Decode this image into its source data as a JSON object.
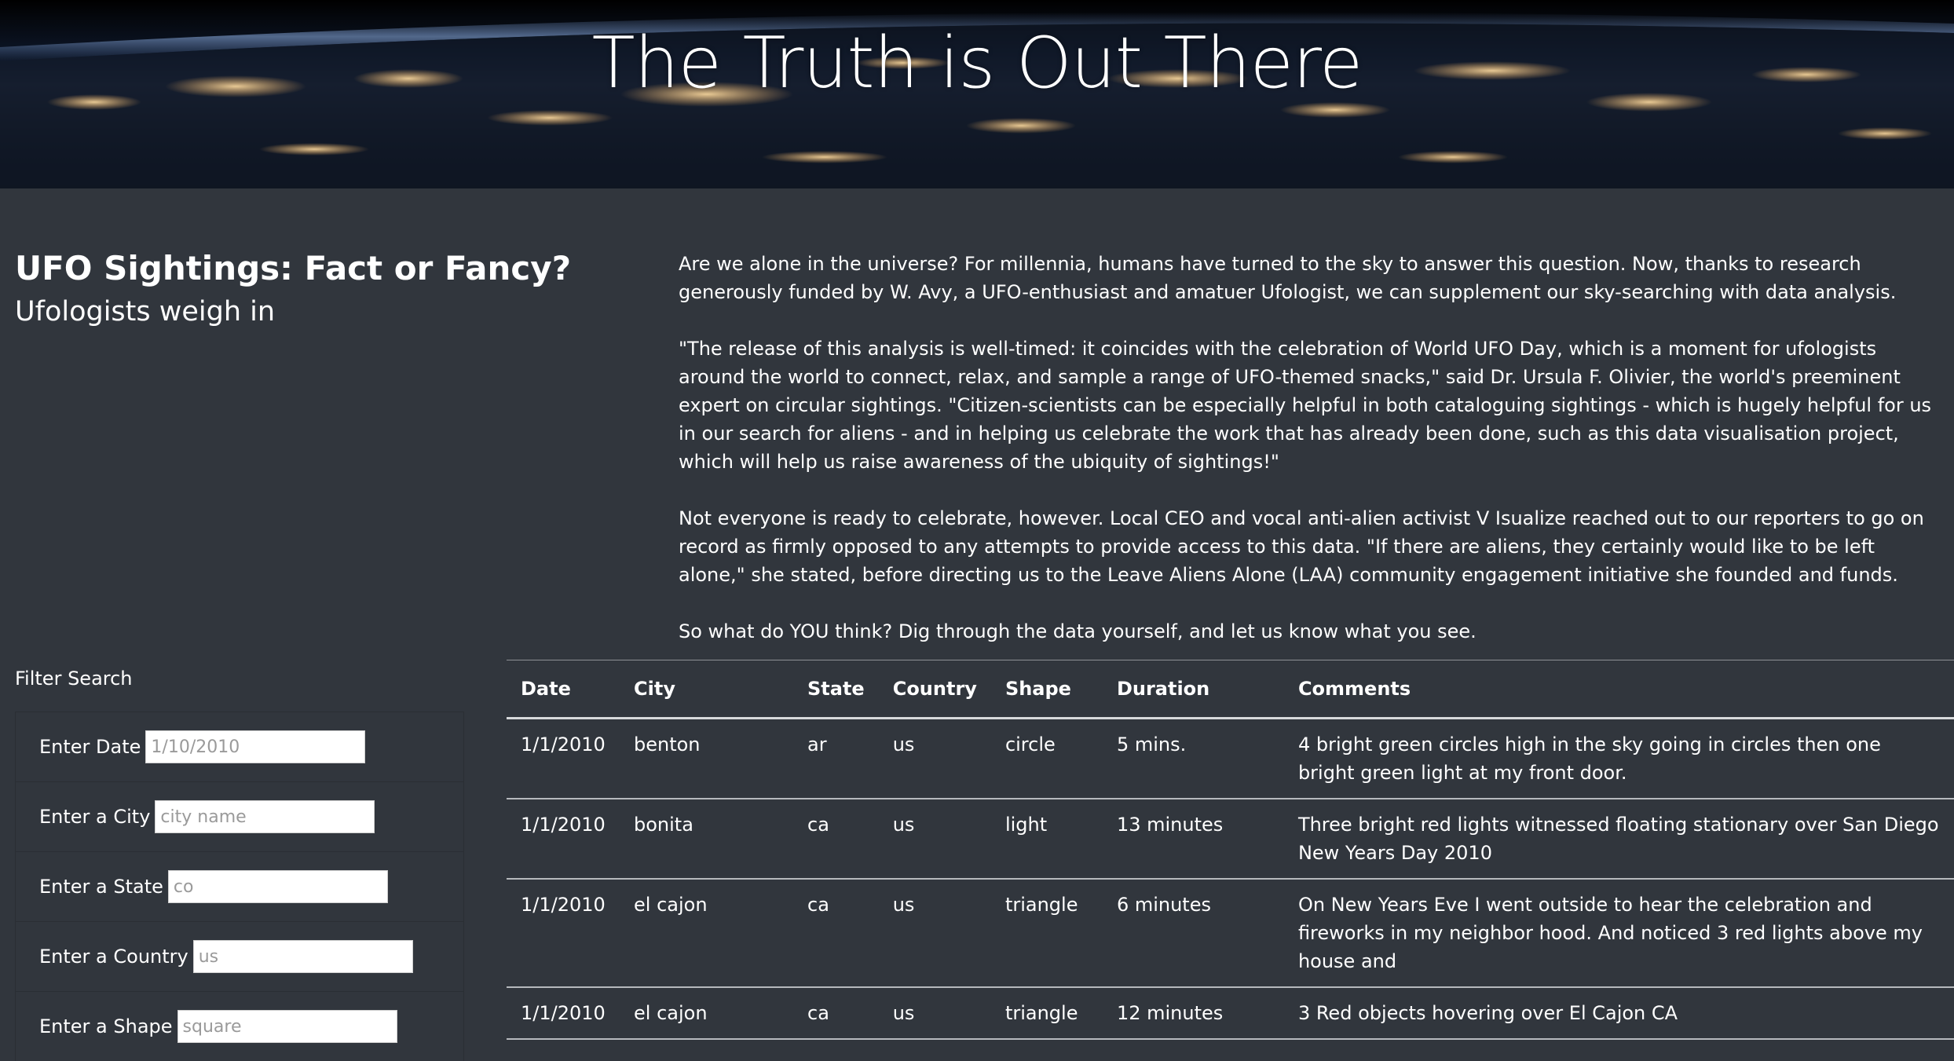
{
  "header": {
    "title": "The Truth is Out There"
  },
  "headline": {
    "main": "UFO Sightings: Fact or Fancy?",
    "sub": "Ufologists weigh in"
  },
  "article": {
    "paragraphs": [
      "Are we alone in the universe? For millennia, humans have turned to the sky to answer this question. Now, thanks to research generously funded by W. Avy, a UFO-enthusiast and amatuer Ufologist, we can supplement our sky-searching with data analysis.",
      "\"The release of this analysis is well-timed: it coincides with the celebration of World UFO Day, which is a moment for ufologists around the world to connect, relax, and sample a range of UFO-themed snacks,\" said Dr. Ursula F. Olivier, the world's preeminent expert on circular sightings. \"Citizen-scientists can be especially helpful in both cataloguing sightings - which is hugely helpful for us in our search for aliens - and in helping us celebrate the work that has already been done, such as this data visualisation project, which will help us raise awareness of the ubiquity of sightings!\"",
      "Not everyone is ready to celebrate, however. Local CEO and vocal anti-alien activist V Isualize reached out to our reporters to go on record as firmly opposed to any attempts to provide access to this data. \"If there are aliens, they certainly would like to be left alone,\" she stated, before directing us to the Leave Aliens Alone (LAA) community engagement initiative she founded and funds.",
      "So what do YOU think? Dig through the data yourself, and let us know what you see."
    ]
  },
  "filters": {
    "title": "Filter Search",
    "items": [
      {
        "label": "Enter Date",
        "placeholder": "1/10/2010"
      },
      {
        "label": "Enter a City",
        "placeholder": "city name"
      },
      {
        "label": "Enter a State",
        "placeholder": "co"
      },
      {
        "label": "Enter a Country",
        "placeholder": "us"
      },
      {
        "label": "Enter a Shape",
        "placeholder": "square"
      }
    ]
  },
  "table": {
    "headers": [
      "Date",
      "City",
      "State",
      "Country",
      "Shape",
      "Duration",
      "Comments"
    ],
    "rows": [
      [
        "1/1/2010",
        "benton",
        "ar",
        "us",
        "circle",
        "5 mins.",
        "4 bright green circles high in the sky going in circles then one bright green light at my front door."
      ],
      [
        "1/1/2010",
        "bonita",
        "ca",
        "us",
        "light",
        "13 minutes",
        "Three bright red lights witnessed floating stationary over San Diego New Years Day 2010"
      ],
      [
        "1/1/2010",
        "el cajon",
        "ca",
        "us",
        "triangle",
        "6 minutes",
        "On New Years Eve I went outside to hear the celebration and fireworks in my neighbor hood. And noticed 3 red lights above my house and"
      ],
      [
        "1/1/2010",
        "el cajon",
        "ca",
        "us",
        "triangle",
        "12 minutes",
        "3 Red objects hovering over El Cajon CA"
      ]
    ]
  }
}
